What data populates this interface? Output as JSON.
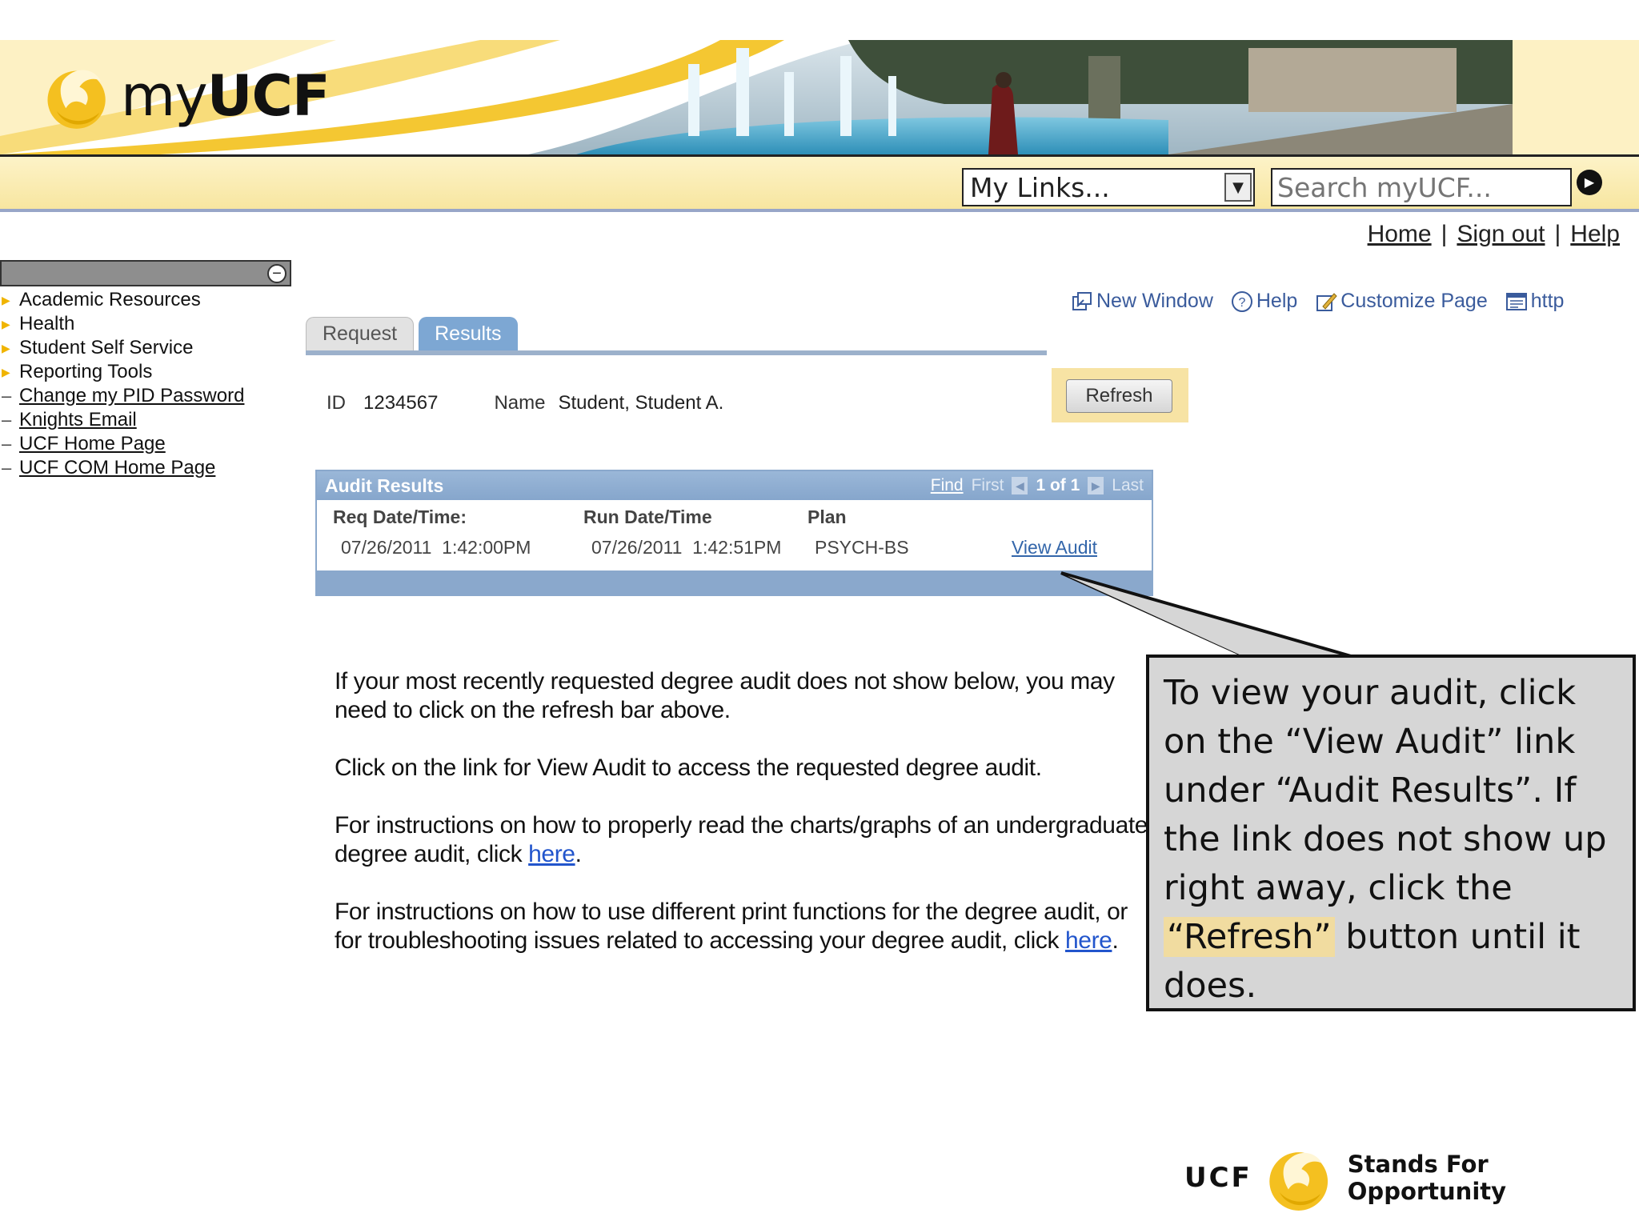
{
  "brand": {
    "logo_my": "my",
    "logo_ucf": "UCF"
  },
  "toolbar": {
    "mylinks_value": "My Links...",
    "search_placeholder": "Search myUCF..."
  },
  "toplinks": {
    "home": "Home",
    "signout": "Sign out",
    "help": "Help",
    "separator": "|"
  },
  "sidebar": {
    "sections": [
      "Academic Resources",
      "Health",
      "Student Self Service",
      "Reporting Tools"
    ],
    "links": [
      "Change my PID Password",
      "Knights Email",
      "UCF Home Page",
      "UCF COM Home Page"
    ]
  },
  "pagetools": {
    "new_window": "New Window",
    "help": "Help",
    "customize": "Customize Page",
    "http": "http"
  },
  "tabs": {
    "request": "Request",
    "results": "Results"
  },
  "student": {
    "id_label": "ID",
    "id_value": "1234567",
    "name_label": "Name",
    "name_value": "Student, Student A."
  },
  "refresh_label": "Refresh",
  "grid": {
    "title": "Audit Results",
    "find": "Find",
    "first": "First",
    "count": "1 of 1",
    "last": "Last",
    "columns": [
      "Req Date/Time:",
      "Run Date/Time",
      "Plan"
    ],
    "row": {
      "req": "07/26/2011  1:42:00PM",
      "run": "07/26/2011  1:42:51PM",
      "plan": "PSYCH-BS",
      "link": "View Audit"
    }
  },
  "instructions": {
    "p1": "If your most recently requested degree audit does not show below, you may need to click on the refresh bar above.",
    "p2": "Click on the link for View Audit to access the requested degree audit.",
    "p3_text": "For instructions on how to properly read the charts/graphs of an undergraduate degree audit, click ",
    "p3_link": "here",
    "p3_end": ".",
    "p4_text": "For instructions on how to use different print functions for the degree audit, or for troubleshooting issues related to accessing your degree audit, click ",
    "p4_link": "here",
    "p4_end": "."
  },
  "callout": {
    "text_before": "To view your audit, click on the “View Audit” link under “Audit Results”. If the link does not show up right away, click the ",
    "highlight": "“Refresh”",
    "text_after": " button until it does."
  },
  "footer": {
    "ucf": "UCF",
    "tagline": "Stands For Opportunity"
  },
  "colors": {
    "gold": "#f0b400",
    "grid_blue": "#8aa8cc",
    "link_blue": "#2255cc"
  }
}
